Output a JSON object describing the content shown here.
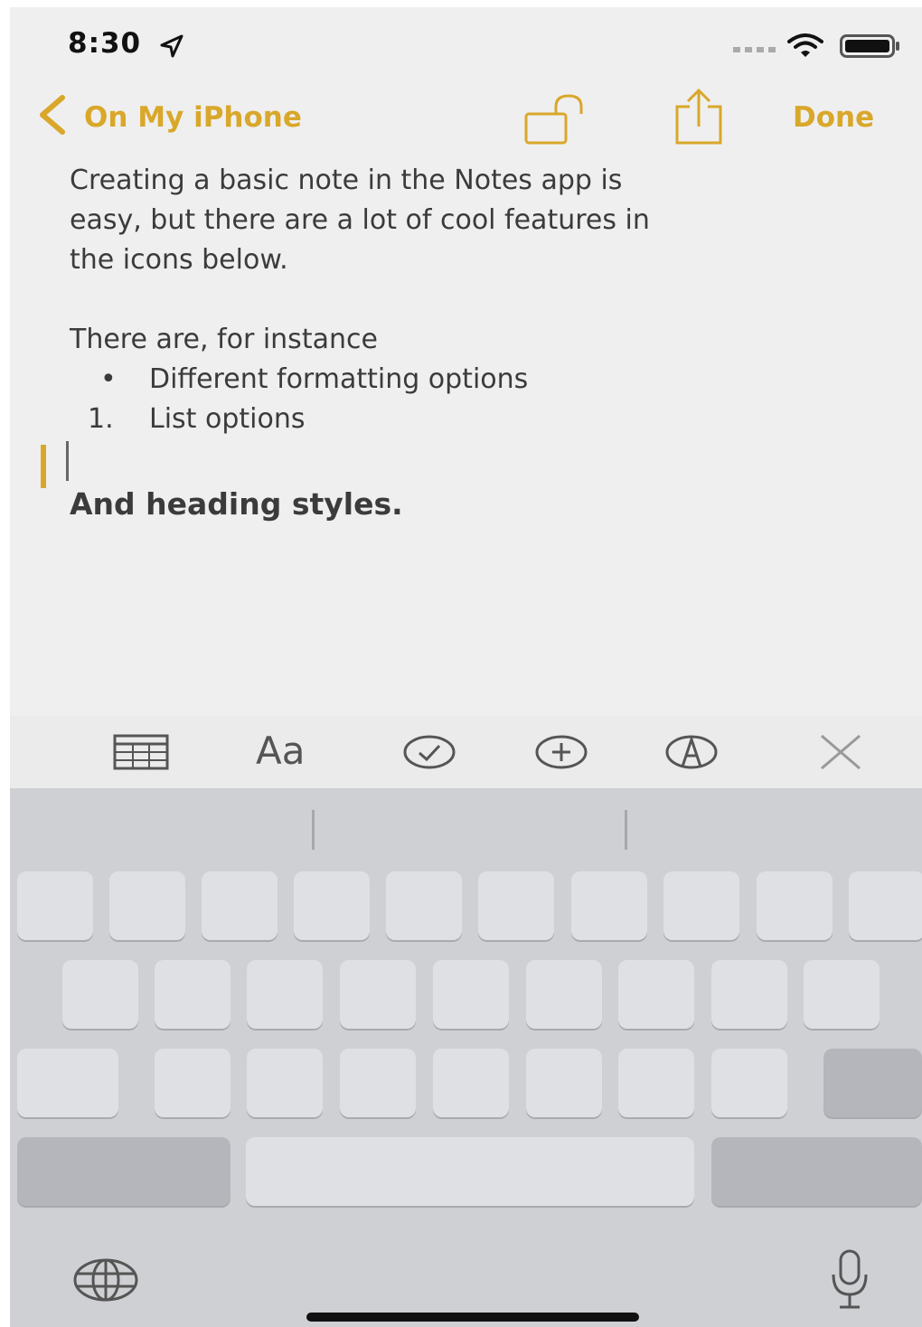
{
  "status_bar": {
    "time": "8:30"
  },
  "nav": {
    "back_label": "On My iPhone",
    "done_label": "Done"
  },
  "note": {
    "paragraph1_line1": "Creating a basic note in the Notes app is",
    "paragraph1_line2": "easy, but there are a lot of cool features in",
    "paragraph1_line3": "the icons below.",
    "paragraph2": "There are, for instance",
    "bullet_mark": "•",
    "bullet_item": "Different formatting options",
    "number_mark": "1.",
    "numbered_item": "List options",
    "heading": "And heading styles."
  },
  "toolbar": {
    "format_label": "Aa",
    "icons": [
      "table-icon",
      "format-icon",
      "checklist-icon",
      "add-icon",
      "markup-icon",
      "close-keyboard-icon"
    ]
  },
  "colors": {
    "accent": "#d9a72a",
    "note_bg": "#efefef",
    "keyboard_bg": "#cfd0d4",
    "key": "#dfe0e3",
    "key_dark": "#b4b6bc"
  }
}
